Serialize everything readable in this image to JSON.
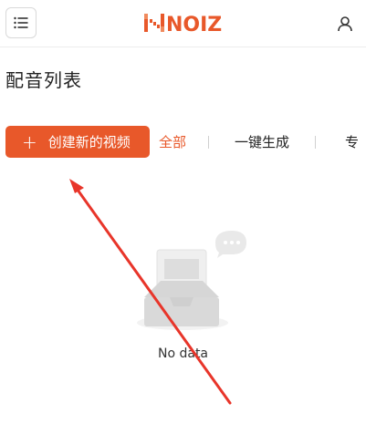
{
  "header": {
    "logo_text": "NOIZ",
    "menu_icon": "list-icon",
    "user_icon": "user-icon"
  },
  "page": {
    "title": "配音列表"
  },
  "actions": {
    "create_label": "创建新的视频",
    "create_icon": "plus-icon"
  },
  "tabs": [
    {
      "label": "全部",
      "active": true
    },
    {
      "label": "一键生成",
      "active": false
    },
    {
      "label": "专",
      "active": false
    }
  ],
  "empty_state": {
    "text": "No data",
    "icon": "empty-inbox-icon"
  },
  "colors": {
    "accent": "#e8582a",
    "annotation": "#e8352a"
  }
}
